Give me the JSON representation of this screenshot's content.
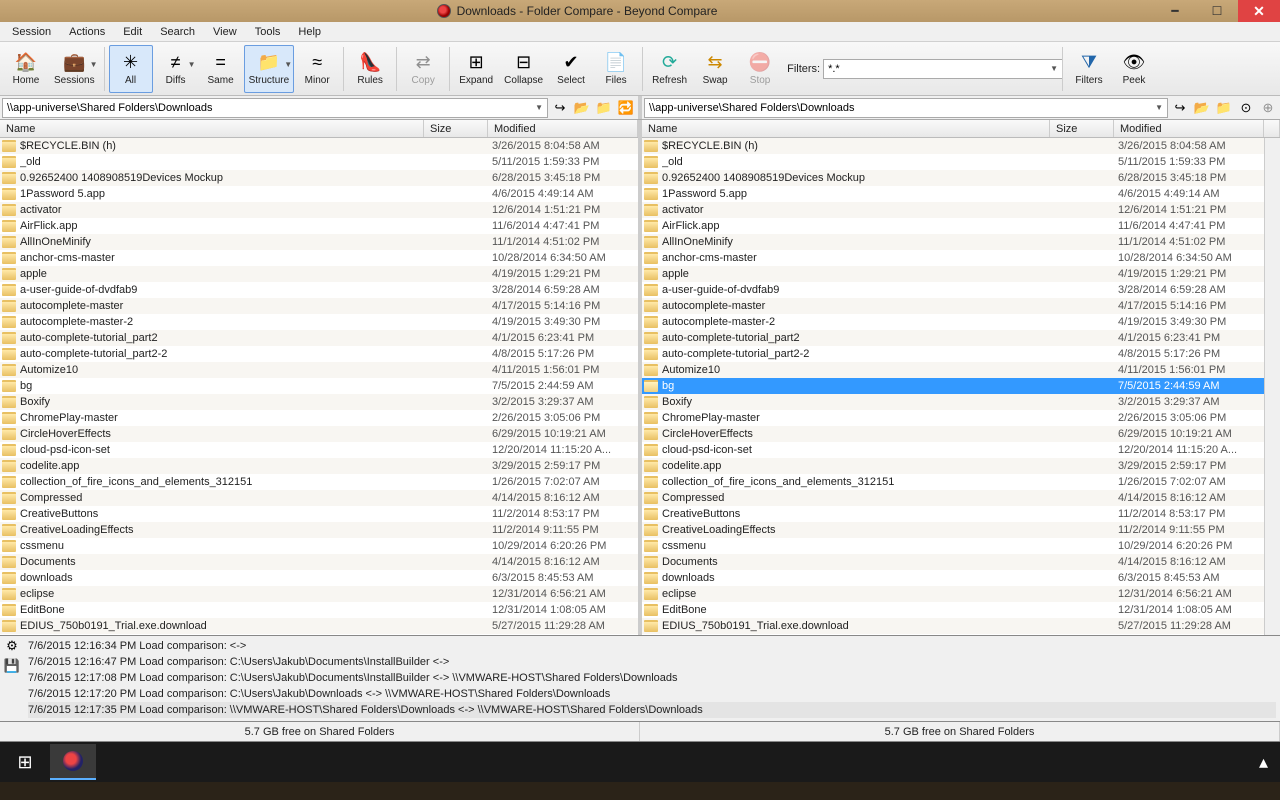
{
  "window": {
    "title": "Downloads - Folder Compare - Beyond Compare"
  },
  "menus": [
    "Session",
    "Actions",
    "Edit",
    "Search",
    "View",
    "Tools",
    "Help"
  ],
  "toolbar": {
    "home": "Home",
    "sessions": "Sessions",
    "all": "All",
    "diffs": "Diffs",
    "same": "Same",
    "structure": "Structure",
    "minor": "Minor",
    "rules": "Rules",
    "copy": "Copy",
    "expand": "Expand",
    "collapse": "Collapse",
    "select": "Select",
    "files": "Files",
    "refresh": "Refresh",
    "swap": "Swap",
    "stop": "Stop",
    "filters_label": "Filters:",
    "filters_value": "*.*",
    "filters": "Filters",
    "peek": "Peek"
  },
  "paths": {
    "left": "\\\\app-universe\\Shared Folders\\Downloads",
    "right": "\\\\app-universe\\Shared Folders\\Downloads"
  },
  "columns": {
    "name": "Name",
    "size": "Size",
    "modified": "Modified"
  },
  "files": [
    {
      "name": "$RECYCLE.BIN (h)",
      "mod": "3/26/2015 8:04:58 AM"
    },
    {
      "name": "_old",
      "mod": "5/11/2015 1:59:33 PM"
    },
    {
      "name": "0.92652400 1408908519Devices Mockup",
      "mod": "6/28/2015 3:45:18 PM"
    },
    {
      "name": "1Password 5.app",
      "mod": "4/6/2015 4:49:14 AM"
    },
    {
      "name": "activator",
      "mod": "12/6/2014 1:51:21 PM"
    },
    {
      "name": "AirFlick.app",
      "mod": "11/6/2014 4:47:41 PM"
    },
    {
      "name": "AllInOneMinify",
      "mod": "11/1/2014 4:51:02 PM"
    },
    {
      "name": "anchor-cms-master",
      "mod": "10/28/2014 6:34:50 AM"
    },
    {
      "name": "apple",
      "mod": "4/19/2015 1:29:21 PM"
    },
    {
      "name": "a-user-guide-of-dvdfab9",
      "mod": "3/28/2014 6:59:28 AM"
    },
    {
      "name": "autocomplete-master",
      "mod": "4/17/2015 5:14:16 PM"
    },
    {
      "name": "autocomplete-master-2",
      "mod": "4/19/2015 3:49:30 PM"
    },
    {
      "name": "auto-complete-tutorial_part2",
      "mod": "4/1/2015 6:23:41 PM"
    },
    {
      "name": "auto-complete-tutorial_part2-2",
      "mod": "4/8/2015 5:17:26 PM"
    },
    {
      "name": "Automize10",
      "mod": "4/11/2015 1:56:01 PM"
    },
    {
      "name": "bg",
      "mod": "7/5/2015 2:44:59 AM",
      "selected": true
    },
    {
      "name": "Boxify",
      "mod": "3/2/2015 3:29:37 AM"
    },
    {
      "name": "ChromePlay-master",
      "mod": "2/26/2015 3:05:06 PM"
    },
    {
      "name": "CircleHoverEffects",
      "mod": "6/29/2015 10:19:21 AM"
    },
    {
      "name": "cloud-psd-icon-set",
      "mod": "12/20/2014 11:15:20 A..."
    },
    {
      "name": "codelite.app",
      "mod": "3/29/2015 2:59:17 PM"
    },
    {
      "name": "collection_of_fire_icons_and_elements_312151",
      "mod": "1/26/2015 7:02:07 AM"
    },
    {
      "name": "Compressed",
      "mod": "4/14/2015 8:16:12 AM"
    },
    {
      "name": "CreativeButtons",
      "mod": "11/2/2014 8:53:17 PM"
    },
    {
      "name": "CreativeLoadingEffects",
      "mod": "11/2/2014 9:11:55 PM"
    },
    {
      "name": "cssmenu",
      "mod": "10/29/2014 6:20:26 PM"
    },
    {
      "name": "Documents",
      "mod": "4/14/2015 8:16:12 AM"
    },
    {
      "name": "downloads",
      "mod": "6/3/2015 8:45:53 AM"
    },
    {
      "name": "eclipse",
      "mod": "12/31/2014 6:56:21 AM"
    },
    {
      "name": "EditBone",
      "mod": "12/31/2014 1:08:05 AM"
    },
    {
      "name": "EDIUS_750b0191_Trial.exe.download",
      "mod": "5/27/2015 11:29:28 AM"
    }
  ],
  "log": [
    "7/6/2015 12:16:34 PM  Load comparison:  <->",
    "7/6/2015 12:16:47 PM  Load comparison:  C:\\Users\\Jakub\\Documents\\InstallBuilder <->",
    "7/6/2015 12:17:08 PM  Load comparison:  C:\\Users\\Jakub\\Documents\\InstallBuilder <-> \\\\VMWARE-HOST\\Shared Folders\\Downloads",
    "7/6/2015 12:17:20 PM  Load comparison:  C:\\Users\\Jakub\\Downloads <-> \\\\VMWARE-HOST\\Shared Folders\\Downloads",
    "7/6/2015 12:17:35 PM  Load comparison:  \\\\VMWARE-HOST\\Shared Folders\\Downloads <-> \\\\VMWARE-HOST\\Shared Folders\\Downloads"
  ],
  "status": {
    "left": "5.7 GB free on Shared Folders",
    "right": "5.7 GB free on Shared Folders"
  }
}
